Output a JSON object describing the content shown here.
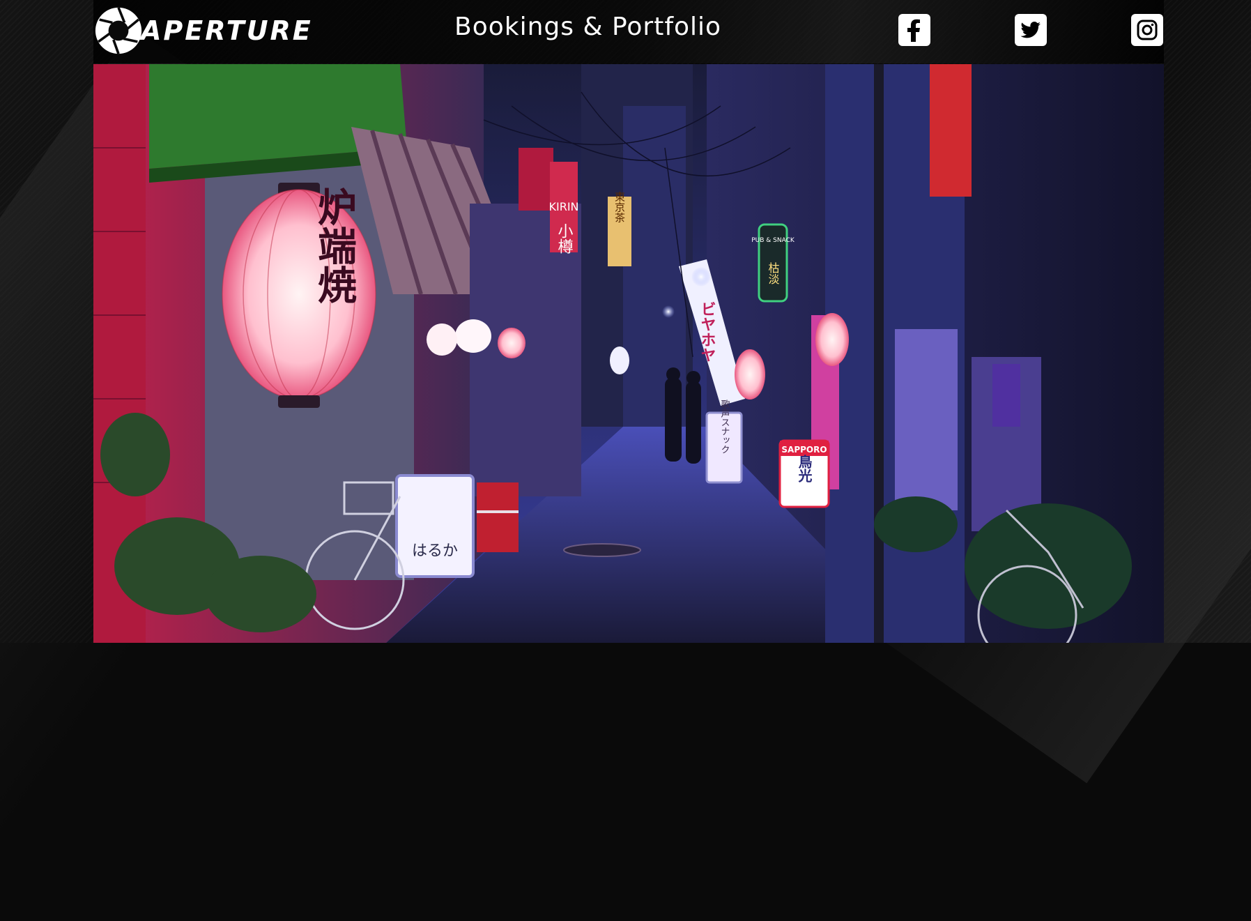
{
  "header": {
    "logo_text": "APERTURE",
    "title": "Bookings & Portfolio"
  },
  "social": [
    {
      "name": "facebook-icon"
    },
    {
      "name": "twitter-icon"
    },
    {
      "name": "instagram-icon"
    }
  ],
  "hero": {
    "lantern_text": "炉端焼",
    "sign_text": "はるか",
    "sapporo_sign": "SAPPORO",
    "sapporo_sub": "鳥光",
    "snack_sign": "歌声スナック",
    "pub_sign": "PUB & SNACK",
    "pub_sub": "枯淡",
    "banner_text": "ビヤホヤ",
    "shop_sign": "小樽",
    "yellow_sign": "東京茶",
    "kirin_sign": "KIRIN"
  },
  "colors": {
    "neon_pink": "#ff2a6a",
    "neon_blue": "#5a5aff",
    "lantern": "#ffd2dc"
  }
}
